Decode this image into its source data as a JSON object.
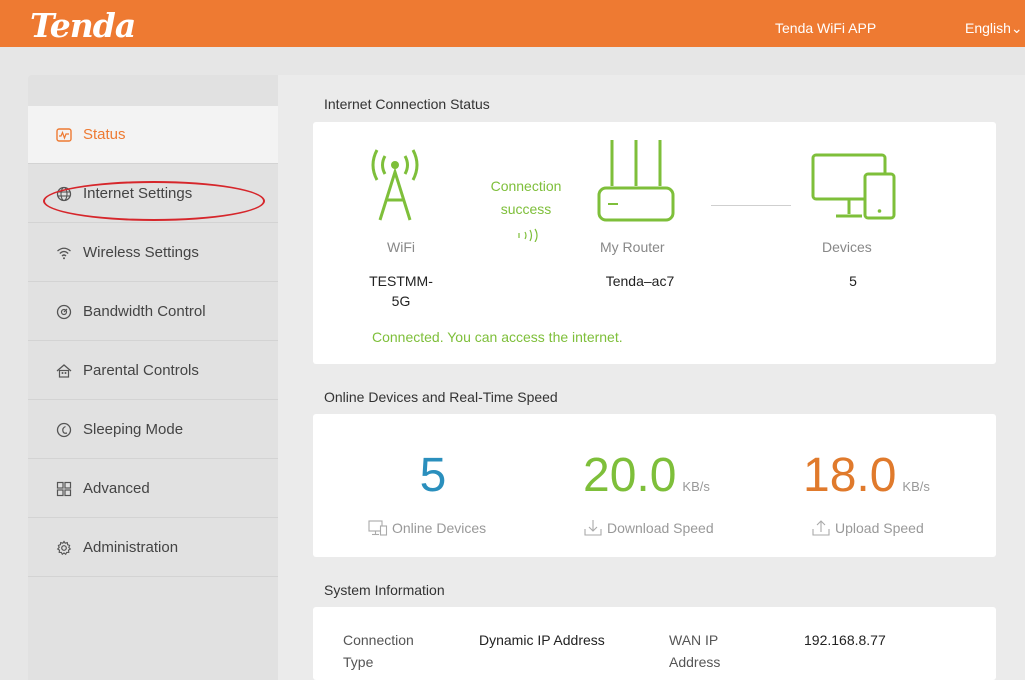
{
  "header": {
    "logo": "Tenda",
    "app_link": "Tenda WiFi APP",
    "language": "English",
    "bar_color": "#ee7a32"
  },
  "sidebar": {
    "items": [
      {
        "label": "Status",
        "icon": "status-icon",
        "active": true
      },
      {
        "label": "Internet Settings",
        "icon": "globe-icon",
        "active": false
      },
      {
        "label": "Wireless Settings",
        "icon": "wifi-icon",
        "active": false
      },
      {
        "label": "Bandwidth Control",
        "icon": "gauge-icon",
        "active": false
      },
      {
        "label": "Parental Controls",
        "icon": "house-icon",
        "active": false
      },
      {
        "label": "Sleeping Mode",
        "icon": "moon-icon",
        "active": false
      },
      {
        "label": "Advanced",
        "icon": "grid-icon",
        "active": false
      },
      {
        "label": "Administration",
        "icon": "gear-icon",
        "active": false
      }
    ],
    "highlight_color": "#d6262b"
  },
  "connection": {
    "section_title": "Internet Connection Status",
    "wifi_label": "WiFi",
    "wifi_name_line1": "TESTMM-",
    "wifi_name_line2": "5G",
    "conn_text_line1": "Connection",
    "conn_text_line2": "success",
    "router_label": "My Router",
    "router_name": "Tenda–ac7",
    "devices_label": "Devices",
    "devices_count": "5",
    "status_message": "Connected. You can access the internet.",
    "accent_green": "#7ebf3a"
  },
  "speed": {
    "section_title": "Online Devices and Real-Time Speed",
    "online_value": "5",
    "online_label": "Online Devices",
    "download_value": "20.0",
    "download_unit": "KB/s",
    "download_label": "Download Speed",
    "upload_value": "18.0",
    "upload_unit": "KB/s",
    "upload_label": "Upload Speed",
    "colors": {
      "online": "#2a8fbd",
      "download": "#7ebf3a",
      "upload": "#e07a2c"
    }
  },
  "system": {
    "section_title": "System Information",
    "conn_type_label_1": "Connection",
    "conn_type_label_2": "Type",
    "conn_type_value": "Dynamic IP Address",
    "wan_ip_label_1": "WAN IP",
    "wan_ip_label_2": "Address",
    "wan_ip_value": "192.168.8.77"
  }
}
